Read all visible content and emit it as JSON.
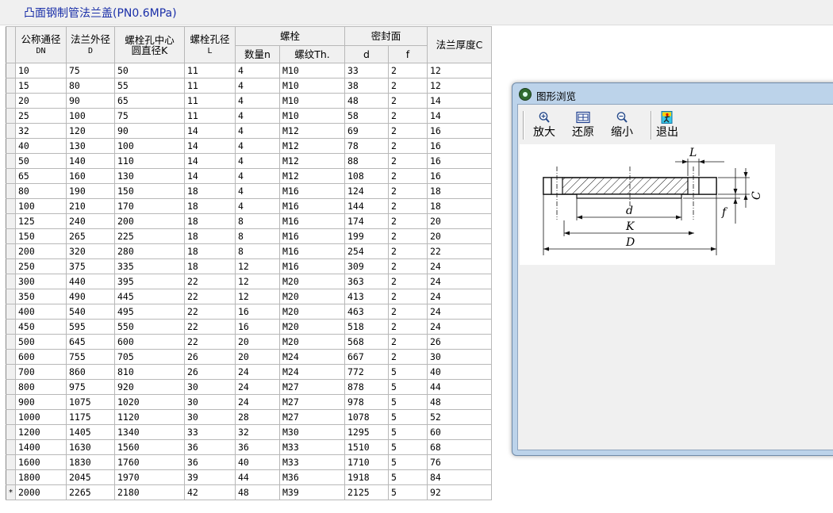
{
  "window": {
    "title": "凸面钢制管法兰盖(PN0.6MPa)"
  },
  "table": {
    "group_headers": {
      "bolt": "螺栓",
      "seal": "密封面"
    },
    "columns": [
      {
        "label": "公称通径",
        "sub": "DN"
      },
      {
        "label": "法兰外径",
        "sub": "D"
      },
      {
        "label": "螺栓孔中心",
        "sub": "圆直径K"
      },
      {
        "label": "螺栓孔径",
        "sub": "L"
      },
      {
        "label": "数量n",
        "sub": ""
      },
      {
        "label": "螺纹Th.",
        "sub": ""
      },
      {
        "label": "d",
        "sub": ""
      },
      {
        "label": "f",
        "sub": ""
      },
      {
        "label": "法兰厚度C",
        "sub": ""
      }
    ],
    "new_row_marker": "*",
    "rows": [
      [
        "10",
        "75",
        "50",
        "11",
        "4",
        "M10",
        "33",
        "2",
        "12"
      ],
      [
        "15",
        "80",
        "55",
        "11",
        "4",
        "M10",
        "38",
        "2",
        "12"
      ],
      [
        "20",
        "90",
        "65",
        "11",
        "4",
        "M10",
        "48",
        "2",
        "14"
      ],
      [
        "25",
        "100",
        "75",
        "11",
        "4",
        "M10",
        "58",
        "2",
        "14"
      ],
      [
        "32",
        "120",
        "90",
        "14",
        "4",
        "M12",
        "69",
        "2",
        "16"
      ],
      [
        "40",
        "130",
        "100",
        "14",
        "4",
        "M12",
        "78",
        "2",
        "16"
      ],
      [
        "50",
        "140",
        "110",
        "14",
        "4",
        "M12",
        "88",
        "2",
        "16"
      ],
      [
        "65",
        "160",
        "130",
        "14",
        "4",
        "M12",
        "108",
        "2",
        "16"
      ],
      [
        "80",
        "190",
        "150",
        "18",
        "4",
        "M16",
        "124",
        "2",
        "18"
      ],
      [
        "100",
        "210",
        "170",
        "18",
        "4",
        "M16",
        "144",
        "2",
        "18"
      ],
      [
        "125",
        "240",
        "200",
        "18",
        "8",
        "M16",
        "174",
        "2",
        "20"
      ],
      [
        "150",
        "265",
        "225",
        "18",
        "8",
        "M16",
        "199",
        "2",
        "20"
      ],
      [
        "200",
        "320",
        "280",
        "18",
        "8",
        "M16",
        "254",
        "2",
        "22"
      ],
      [
        "250",
        "375",
        "335",
        "18",
        "12",
        "M16",
        "309",
        "2",
        "24"
      ],
      [
        "300",
        "440",
        "395",
        "22",
        "12",
        "M20",
        "363",
        "2",
        "24"
      ],
      [
        "350",
        "490",
        "445",
        "22",
        "12",
        "M20",
        "413",
        "2",
        "24"
      ],
      [
        "400",
        "540",
        "495",
        "22",
        "16",
        "M20",
        "463",
        "2",
        "24"
      ],
      [
        "450",
        "595",
        "550",
        "22",
        "16",
        "M20",
        "518",
        "2",
        "24"
      ],
      [
        "500",
        "645",
        "600",
        "22",
        "20",
        "M20",
        "568",
        "2",
        "26"
      ],
      [
        "600",
        "755",
        "705",
        "26",
        "20",
        "M24",
        "667",
        "2",
        "30"
      ],
      [
        "700",
        "860",
        "810",
        "26",
        "24",
        "M24",
        "772",
        "5",
        "40"
      ],
      [
        "800",
        "975",
        "920",
        "30",
        "24",
        "M27",
        "878",
        "5",
        "44"
      ],
      [
        "900",
        "1075",
        "1020",
        "30",
        "24",
        "M27",
        "978",
        "5",
        "48"
      ],
      [
        "1000",
        "1175",
        "1120",
        "30",
        "28",
        "M27",
        "1078",
        "5",
        "52"
      ],
      [
        "1200",
        "1405",
        "1340",
        "33",
        "32",
        "M30",
        "1295",
        "5",
        "60"
      ],
      [
        "1400",
        "1630",
        "1560",
        "36",
        "36",
        "M33",
        "1510",
        "5",
        "68"
      ],
      [
        "1600",
        "1830",
        "1760",
        "36",
        "40",
        "M33",
        "1710",
        "5",
        "76"
      ],
      [
        "1800",
        "2045",
        "1970",
        "39",
        "44",
        "M36",
        "1918",
        "5",
        "84"
      ],
      [
        "2000",
        "2265",
        "2180",
        "42",
        "48",
        "M39",
        "2125",
        "5",
        "92"
      ]
    ]
  },
  "viewer": {
    "title": "图形浏览",
    "toolbar": {
      "zoom_in": "放大",
      "restore": "还原",
      "zoom_out": "缩小",
      "exit": "退出"
    },
    "drawing_labels": {
      "L": "L",
      "C": "C",
      "f": "f",
      "d": "d",
      "K": "K",
      "D": "D"
    },
    "icons": [
      "zoom-in-icon",
      "restore-icon",
      "zoom-out-icon",
      "exit-icon"
    ]
  }
}
